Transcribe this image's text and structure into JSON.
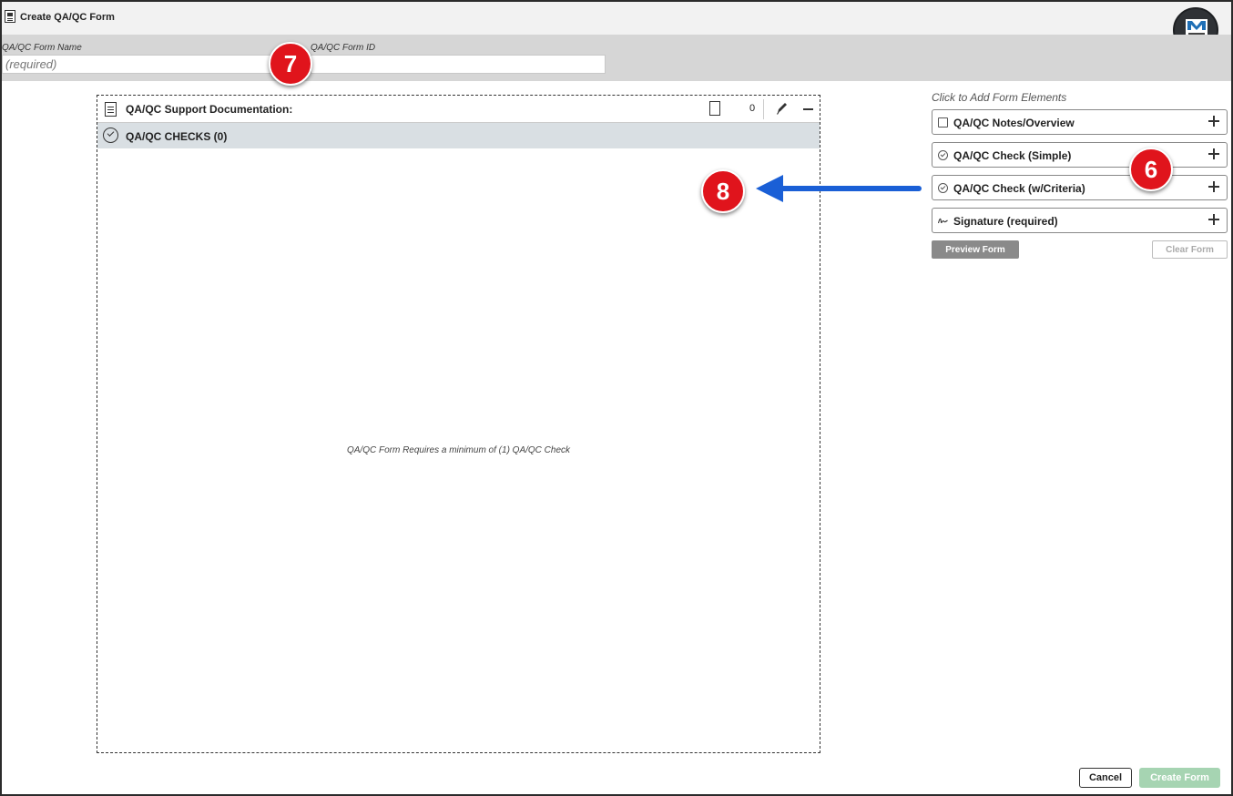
{
  "window": {
    "title": "Create QA/QC Form"
  },
  "header": {
    "form_name_label": "QA/QC Form Name",
    "form_name_placeholder": "(required)",
    "form_id_label": "QA/QC Form ID",
    "form_id_value": ""
  },
  "annotations": {
    "badge_7": "7",
    "badge_6": "6",
    "badge_8": "8"
  },
  "canvas": {
    "doc_title": "QA/QC Support Documentation:",
    "doc_count": "0",
    "checks_title": "QA/QC CHECKS (0)",
    "empty_message": "QA/QC Form Requires a minimum of (1) QA/QC Check"
  },
  "panel": {
    "hint": "Click to Add Form Elements",
    "elements": [
      {
        "label": "QA/QC Notes/Overview",
        "icon": "note-icon"
      },
      {
        "label": "QA/QC Check (Simple)",
        "icon": "check-circle-icon"
      },
      {
        "label": "QA/QC Check (w/Criteria)",
        "icon": "check-circle-icon"
      },
      {
        "label": "Signature (required)",
        "icon": "signature-icon"
      }
    ],
    "preview_label": "Preview Form",
    "clear_label": "Clear Form"
  },
  "footer": {
    "cancel_label": "Cancel",
    "create_label": "Create Form"
  },
  "colors": {
    "badge": "#e0141c",
    "arrow": "#1a5fd6",
    "create_button": "#a6d4b2",
    "header_bar": "#d6d6d6"
  }
}
